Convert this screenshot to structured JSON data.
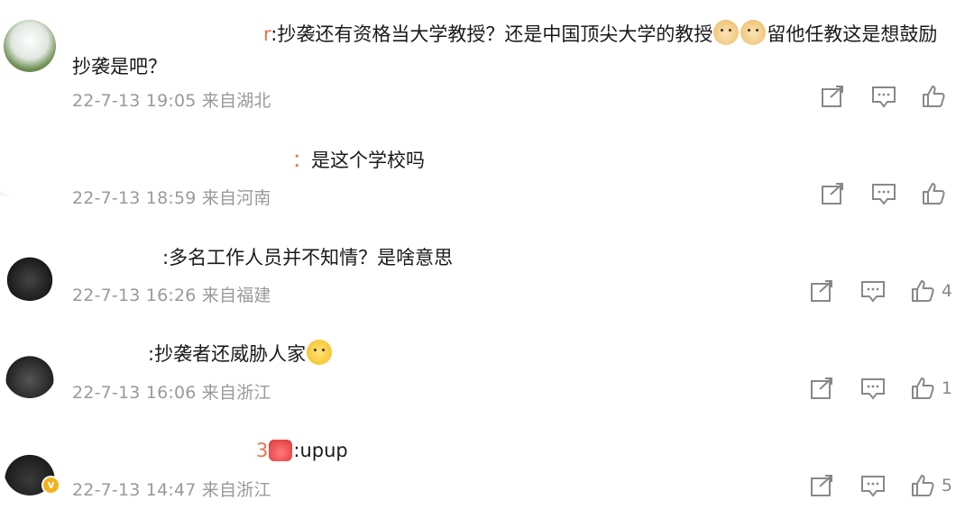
{
  "comments": [
    {
      "name_tail": "r",
      "text": ":抄袭还有资格当大学教授？还是中国顶尖大学的教授",
      "text_tail": "留他任教这是想鼓励抄袭是吧？",
      "time": "22-7-13 19:05 来自湖北",
      "emojis": [
        "doge-emoji",
        "doge-emoji"
      ],
      "likes": ""
    },
    {
      "name_tail": "：",
      "text": "是这个学校吗",
      "time": "22-7-13 18:59 来自河南",
      "likes": ""
    },
    {
      "name_tail": "",
      "text": ":多名工作人员并不知情？是啥意思",
      "time": "22-7-13 16:26 来自福建",
      "likes": "4"
    },
    {
      "name_tail": "",
      "text": ":抄袭者还威胁人家",
      "time": "22-7-13 16:06 来自浙江",
      "emojis": [
        "laugh-cry-emoji"
      ],
      "likes": "1"
    },
    {
      "name_tail": "3",
      "text": ":upup",
      "time": "22-7-13 14:47 来自浙江",
      "emojis": [
        "crown-badge"
      ],
      "likes": "5"
    }
  ],
  "icons": [
    "share-icon",
    "comment-icon",
    "like-icon",
    "verified-badge-icon"
  ],
  "colors": {
    "text": "#1a1a1a",
    "meta": "#9a9a9a",
    "icon": "#888888",
    "name": "#e5734a",
    "verified": "#f3b21a"
  }
}
